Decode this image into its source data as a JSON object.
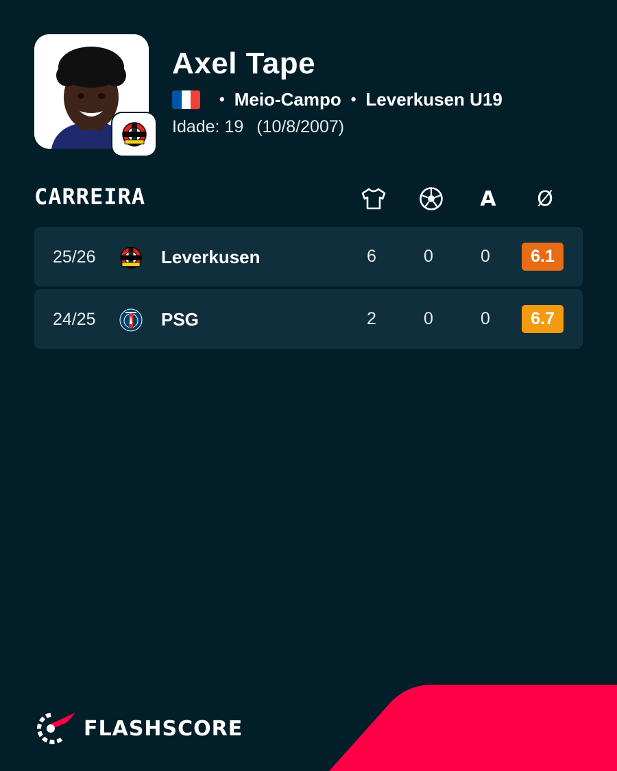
{
  "player": {
    "name": "Axel Tape",
    "position": "Meio-Campo",
    "club": "Leverkusen U19",
    "age_label": "Idade: 19",
    "birth_date": "(10/8/2007)",
    "flag_colors": [
      "#0055a4",
      "#ffffff",
      "#ef4135"
    ]
  },
  "career": {
    "title": "CARREIRA",
    "columns": [
      {
        "icon": "shirt-icon"
      },
      {
        "icon": "ball-icon"
      },
      {
        "label": "A"
      },
      {
        "label": "Ø"
      }
    ],
    "rows": [
      {
        "season": "25/26",
        "team": "Leverkusen",
        "logo": "leverkusen-logo",
        "apps": "6",
        "goals": "0",
        "assists": "0",
        "rating": "6.1",
        "rating_color": "#e86b15"
      },
      {
        "season": "24/25",
        "team": "PSG",
        "logo": "psg-logo",
        "apps": "2",
        "goals": "0",
        "assists": "0",
        "rating": "6.7",
        "rating_color": "#f39a11"
      }
    ]
  },
  "brand": {
    "name": "FLASHSCORE",
    "accent_color": "#ff0046"
  },
  "colors": {
    "background": "#011e29",
    "row_background": "#0e2f3b"
  }
}
